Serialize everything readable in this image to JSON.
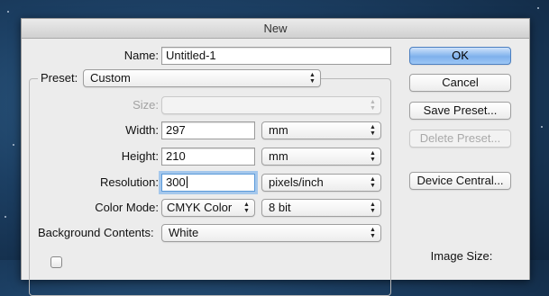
{
  "dialog": {
    "title": "New"
  },
  "form": {
    "name_label": "Name:",
    "name_value": "Untitled-1",
    "preset_label": "Preset:",
    "preset_value": "Custom",
    "size_label": "Size:",
    "size_value": "",
    "width_label": "Width:",
    "width_value": "297",
    "width_unit": "mm",
    "height_label": "Height:",
    "height_value": "210",
    "height_unit": "mm",
    "resolution_label": "Resolution:",
    "resolution_value": "300",
    "resolution_unit": "pixels/inch",
    "color_mode_label": "Color Mode:",
    "color_mode_value": "CMYK Color",
    "bit_depth_value": "8 bit",
    "background_label": "Background Contents:",
    "background_value": "White"
  },
  "buttons": {
    "ok": "OK",
    "cancel": "Cancel",
    "save_preset": "Save Preset...",
    "delete_preset": "Delete Preset...",
    "device_central": "Device Central..."
  },
  "info": {
    "image_size_label": "Image Size:"
  },
  "icons": {
    "popup_arrows": "▲▼"
  },
  "colors": {
    "default_button": "#7fb1ec",
    "focus_ring": "#a4c7ec"
  }
}
